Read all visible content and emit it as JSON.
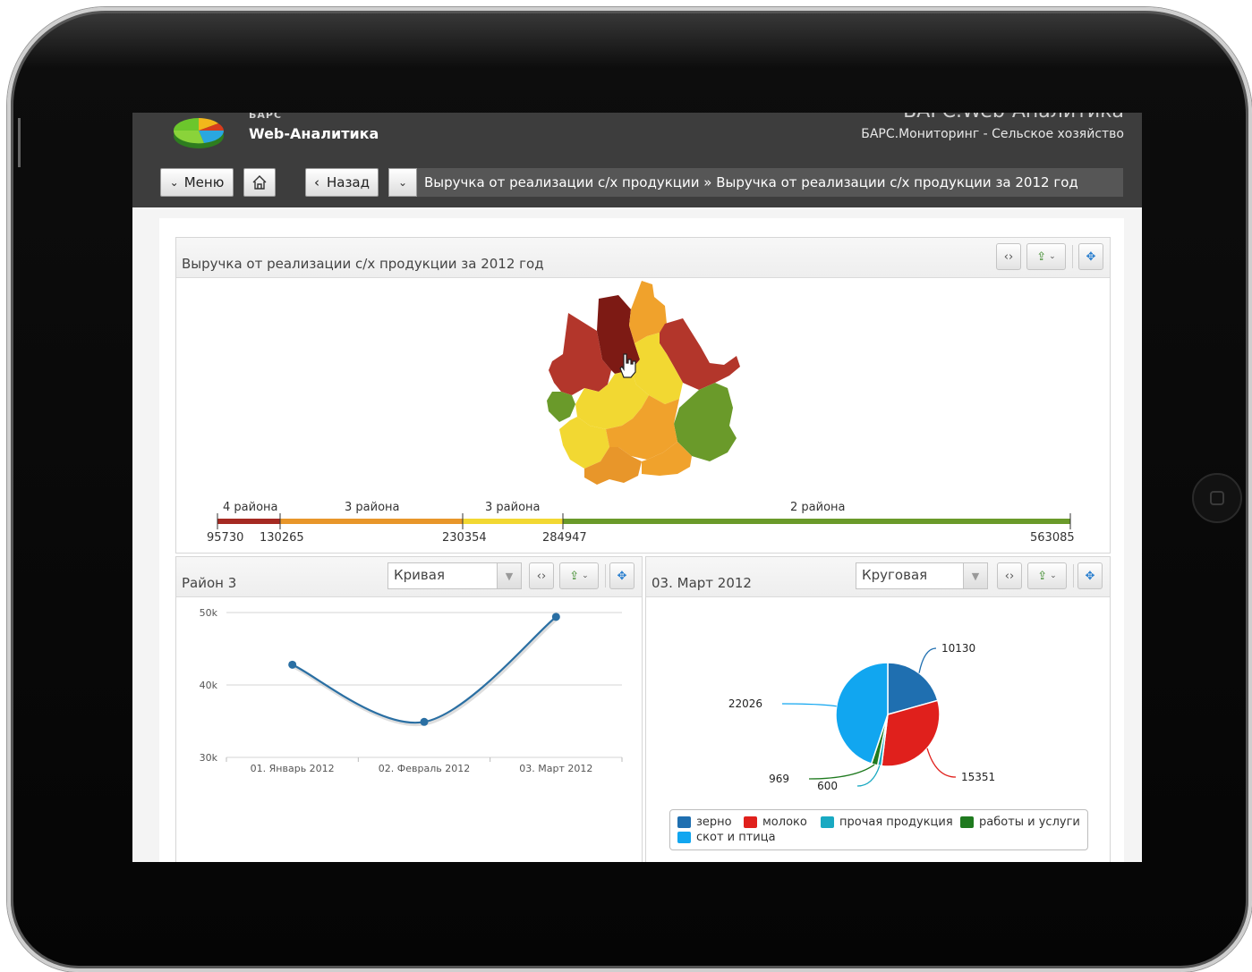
{
  "app": {
    "brand_small": "БАРС",
    "brand": "Web-Аналитика",
    "title": "БАРС.Web-Аналитика",
    "subtitle": "БАРС.Мониторинг - Сельское хозяйство"
  },
  "nav": {
    "menu_label": "Меню",
    "back_label": "Назад",
    "breadcrumb": "Выручка от реализации с/х продукции » Выручка от реализации с/х продукции за 2012 год"
  },
  "map_panel": {
    "title": "Выручка от реализации с/х продукции за 2012 год",
    "scale": {
      "groups": [
        "4 района",
        "3 района",
        "3 района",
        "2 района"
      ],
      "breaks": [
        "95730",
        "130265",
        "230354",
        "284947",
        "563085"
      ],
      "colors": [
        "#a52a22",
        "#e8962a",
        "#f2d832",
        "#6a9a2a"
      ]
    }
  },
  "line_panel": {
    "title": "Район 3",
    "chart_type_value": "Кривая",
    "chart_data": {
      "type": "line",
      "categories": [
        "01. Январь 2012",
        "02. Февраль 2012",
        "03. Март 2012"
      ],
      "series": [
        {
          "values": [
            42800,
            34900,
            49400
          ]
        }
      ],
      "y_ticks": [
        "30k",
        "40k",
        "50k"
      ],
      "ylim": [
        30000,
        50000
      ],
      "grid": true,
      "color": "#2a6fa3"
    }
  },
  "pie_panel": {
    "title": "03. Март 2012",
    "chart_type_value": "Круговая",
    "chart_data": {
      "type": "pie",
      "slices": [
        {
          "label": "зерно",
          "value": 10130,
          "color": "#1f6fb0"
        },
        {
          "label": "молоко",
          "value": 15351,
          "color": "#e0201c"
        },
        {
          "label": "прочая продукция",
          "value": 600,
          "color": "#19a9c2"
        },
        {
          "label": "работы и услуги",
          "value": 969,
          "color": "#1f7a1f"
        },
        {
          "label": "скот и птица",
          "value": 22026,
          "color": "#11a6f0"
        }
      ],
      "legend_placement": "bottom"
    }
  }
}
